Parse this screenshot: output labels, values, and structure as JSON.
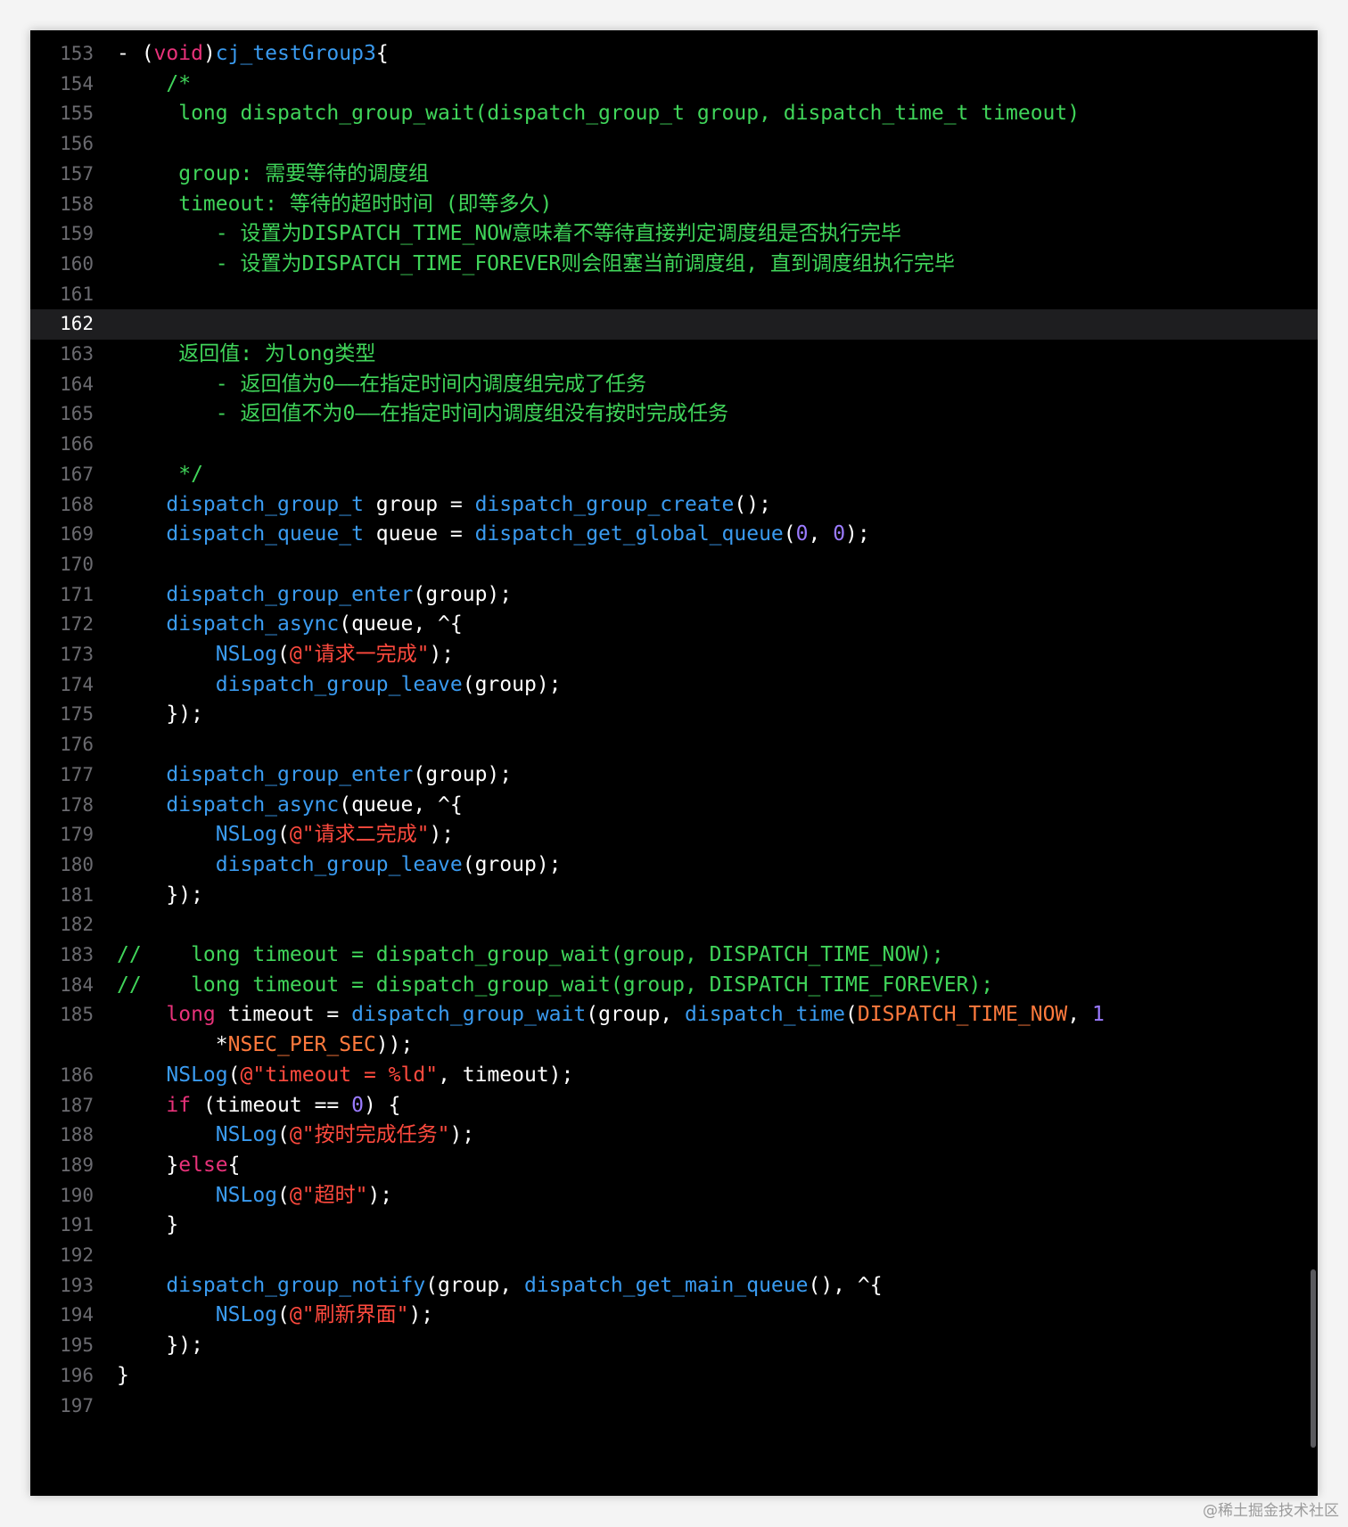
{
  "colors": {
    "background": "#000000",
    "plain": "#ffffff",
    "comment": "#40d55a",
    "keyword": "#e8327a",
    "function": "#3a9bf0",
    "string": "#ff4a3e",
    "number": "#9b7bff",
    "macro": "#ff7a3d",
    "line_number": "#6b6b70"
  },
  "current_line": "162",
  "watermark": "@稀土掘金技术社区",
  "lines": [
    {
      "n": "153",
      "segs": [
        [
          "plain",
          "- ("
        ],
        [
          "keyword",
          "void"
        ],
        [
          "plain",
          ")"
        ],
        [
          "function",
          "cj_testGroup3"
        ],
        [
          "plain",
          "{"
        ]
      ]
    },
    {
      "n": "154",
      "segs": [
        [
          "comment",
          "    /*"
        ]
      ]
    },
    {
      "n": "155",
      "segs": [
        [
          "comment",
          "     long dispatch_group_wait(dispatch_group_t group, dispatch_time_t timeout)"
        ]
      ]
    },
    {
      "n": "156",
      "segs": []
    },
    {
      "n": "157",
      "segs": [
        [
          "comment",
          "     group: 需要等待的调度组"
        ]
      ]
    },
    {
      "n": "158",
      "segs": [
        [
          "comment",
          "     timeout: 等待的超时时间 (即等多久)"
        ]
      ]
    },
    {
      "n": "159",
      "segs": [
        [
          "comment",
          "        - 设置为DISPATCH_TIME_NOW意味着不等待直接判定调度组是否执行完毕"
        ]
      ]
    },
    {
      "n": "160",
      "segs": [
        [
          "comment",
          "        - 设置为DISPATCH_TIME_FOREVER则会阻塞当前调度组, 直到调度组执行完毕"
        ]
      ]
    },
    {
      "n": "161",
      "segs": []
    },
    {
      "n": "162",
      "segs": []
    },
    {
      "n": "163",
      "segs": [
        [
          "comment",
          "     返回值: 为long类型"
        ]
      ]
    },
    {
      "n": "164",
      "segs": [
        [
          "comment",
          "        - 返回值为0——在指定时间内调度组完成了任务"
        ]
      ]
    },
    {
      "n": "165",
      "segs": [
        [
          "comment",
          "        - 返回值不为0——在指定时间内调度组没有按时完成任务"
        ]
      ]
    },
    {
      "n": "166",
      "segs": []
    },
    {
      "n": "167",
      "segs": [
        [
          "comment",
          "     */"
        ]
      ]
    },
    {
      "n": "168",
      "segs": [
        [
          "plain",
          "    "
        ],
        [
          "function",
          "dispatch_group_t"
        ],
        [
          "plain",
          " group = "
        ],
        [
          "function",
          "dispatch_group_create"
        ],
        [
          "plain",
          "();"
        ]
      ]
    },
    {
      "n": "169",
      "segs": [
        [
          "plain",
          "    "
        ],
        [
          "function",
          "dispatch_queue_t"
        ],
        [
          "plain",
          " queue = "
        ],
        [
          "function",
          "dispatch_get_global_queue"
        ],
        [
          "plain",
          "("
        ],
        [
          "number",
          "0"
        ],
        [
          "plain",
          ", "
        ],
        [
          "number",
          "0"
        ],
        [
          "plain",
          ");"
        ]
      ]
    },
    {
      "n": "170",
      "segs": []
    },
    {
      "n": "171",
      "segs": [
        [
          "plain",
          "    "
        ],
        [
          "function",
          "dispatch_group_enter"
        ],
        [
          "plain",
          "(group);"
        ]
      ]
    },
    {
      "n": "172",
      "segs": [
        [
          "plain",
          "    "
        ],
        [
          "function",
          "dispatch_async"
        ],
        [
          "plain",
          "(queue, ^{"
        ]
      ]
    },
    {
      "n": "173",
      "segs": [
        [
          "plain",
          "        "
        ],
        [
          "function",
          "NSLog"
        ],
        [
          "plain",
          "("
        ],
        [
          "string",
          "@\"请求一完成\""
        ],
        [
          "plain",
          ");"
        ]
      ]
    },
    {
      "n": "174",
      "segs": [
        [
          "plain",
          "        "
        ],
        [
          "function",
          "dispatch_group_leave"
        ],
        [
          "plain",
          "(group);"
        ]
      ]
    },
    {
      "n": "175",
      "segs": [
        [
          "plain",
          "    });"
        ]
      ]
    },
    {
      "n": "176",
      "segs": []
    },
    {
      "n": "177",
      "segs": [
        [
          "plain",
          "    "
        ],
        [
          "function",
          "dispatch_group_enter"
        ],
        [
          "plain",
          "(group);"
        ]
      ]
    },
    {
      "n": "178",
      "segs": [
        [
          "plain",
          "    "
        ],
        [
          "function",
          "dispatch_async"
        ],
        [
          "plain",
          "(queue, ^{"
        ]
      ]
    },
    {
      "n": "179",
      "segs": [
        [
          "plain",
          "        "
        ],
        [
          "function",
          "NSLog"
        ],
        [
          "plain",
          "("
        ],
        [
          "string",
          "@\"请求二完成\""
        ],
        [
          "plain",
          ");"
        ]
      ]
    },
    {
      "n": "180",
      "segs": [
        [
          "plain",
          "        "
        ],
        [
          "function",
          "dispatch_group_leave"
        ],
        [
          "plain",
          "(group);"
        ]
      ]
    },
    {
      "n": "181",
      "segs": [
        [
          "plain",
          "    });"
        ]
      ]
    },
    {
      "n": "182",
      "segs": []
    },
    {
      "n": "183",
      "segs": [
        [
          "comment",
          "//    long timeout = dispatch_group_wait(group, DISPATCH_TIME_NOW);"
        ]
      ]
    },
    {
      "n": "184",
      "segs": [
        [
          "comment",
          "//    long timeout = dispatch_group_wait(group, DISPATCH_TIME_FOREVER);"
        ]
      ]
    },
    {
      "n": "185",
      "segs": [
        [
          "plain",
          "    "
        ],
        [
          "keyword",
          "long"
        ],
        [
          "plain",
          " timeout = "
        ],
        [
          "function",
          "dispatch_group_wait"
        ],
        [
          "plain",
          "(group, "
        ],
        [
          "function",
          "dispatch_time"
        ],
        [
          "plain",
          "("
        ],
        [
          "macro",
          "DISPATCH_TIME_NOW"
        ],
        [
          "plain",
          ", "
        ],
        [
          "number",
          "1"
        ]
      ]
    },
    {
      "n": "",
      "segs": [
        [
          "plain",
          "        *"
        ],
        [
          "macro",
          "NSEC_PER_SEC"
        ],
        [
          "plain",
          "));"
        ]
      ]
    },
    {
      "n": "186",
      "segs": [
        [
          "plain",
          "    "
        ],
        [
          "function",
          "NSLog"
        ],
        [
          "plain",
          "("
        ],
        [
          "string",
          "@\"timeout = %ld\""
        ],
        [
          "plain",
          ", timeout);"
        ]
      ]
    },
    {
      "n": "187",
      "segs": [
        [
          "plain",
          "    "
        ],
        [
          "keyword",
          "if"
        ],
        [
          "plain",
          " (timeout == "
        ],
        [
          "number",
          "0"
        ],
        [
          "plain",
          ") {"
        ]
      ]
    },
    {
      "n": "188",
      "segs": [
        [
          "plain",
          "        "
        ],
        [
          "function",
          "NSLog"
        ],
        [
          "plain",
          "("
        ],
        [
          "string",
          "@\"按时完成任务\""
        ],
        [
          "plain",
          ");"
        ]
      ]
    },
    {
      "n": "189",
      "segs": [
        [
          "plain",
          "    }"
        ],
        [
          "keyword",
          "else"
        ],
        [
          "plain",
          "{"
        ]
      ]
    },
    {
      "n": "190",
      "segs": [
        [
          "plain",
          "        "
        ],
        [
          "function",
          "NSLog"
        ],
        [
          "plain",
          "("
        ],
        [
          "string",
          "@\"超时\""
        ],
        [
          "plain",
          ");"
        ]
      ]
    },
    {
      "n": "191",
      "segs": [
        [
          "plain",
          "    }"
        ]
      ]
    },
    {
      "n": "192",
      "segs": []
    },
    {
      "n": "193",
      "segs": [
        [
          "plain",
          "    "
        ],
        [
          "function",
          "dispatch_group_notify"
        ],
        [
          "plain",
          "(group, "
        ],
        [
          "function",
          "dispatch_get_main_queue"
        ],
        [
          "plain",
          "(), ^{"
        ]
      ]
    },
    {
      "n": "194",
      "segs": [
        [
          "plain",
          "        "
        ],
        [
          "function",
          "NSLog"
        ],
        [
          "plain",
          "("
        ],
        [
          "string",
          "@\"刷新界面\""
        ],
        [
          "plain",
          ");"
        ]
      ]
    },
    {
      "n": "195",
      "segs": [
        [
          "plain",
          "    });"
        ]
      ]
    },
    {
      "n": "196",
      "segs": [
        [
          "plain",
          "}"
        ]
      ]
    },
    {
      "n": "197",
      "segs": []
    }
  ]
}
